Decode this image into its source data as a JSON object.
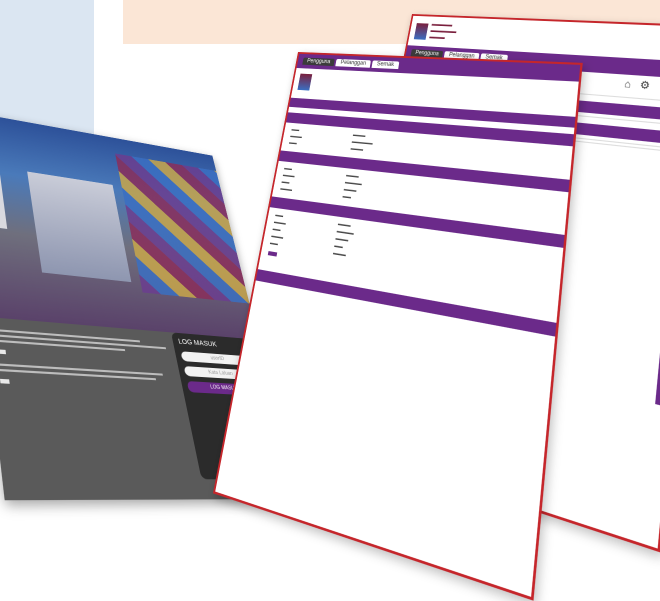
{
  "login": {
    "title": "LOG MASUK",
    "field1": "userID",
    "field2": "Kata Laluan",
    "button": "LOG MASUK"
  },
  "portal": {
    "tabs": [
      "Pengguna",
      "Pelanggan",
      "Semak"
    ],
    "favourite_label": "favourite"
  },
  "colors": {
    "accent": "#6b2a8a",
    "border": "#c5262b",
    "peach": "#fbe6d6",
    "blue": "#dbe6f2"
  }
}
